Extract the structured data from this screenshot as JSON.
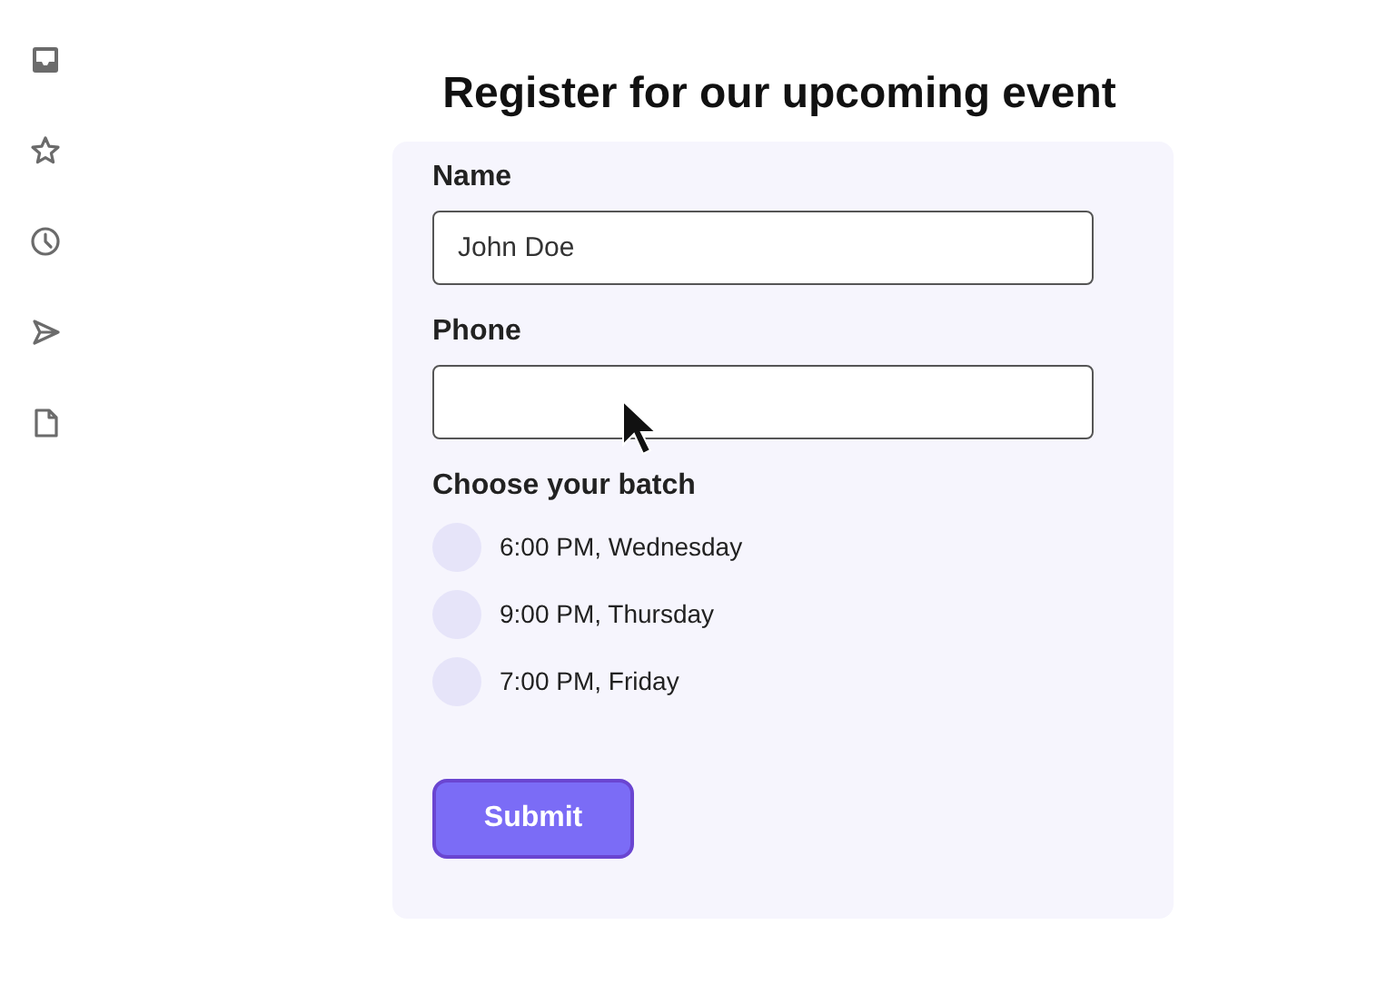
{
  "form": {
    "title": "Register for our upcoming event",
    "fields": [
      {
        "label": "Name",
        "value": "John Doe"
      },
      {
        "label": "Phone"
      }
    ],
    "batch": {
      "label": "Choose your batch",
      "options": [
        {
          "label": "6:00 PM, Wednesday",
          "selected": false
        },
        {
          "label": "9:00 PM, Thursday",
          "selected": false
        },
        {
          "label": "7:00 PM, Friday",
          "selected": false
        }
      ]
    },
    "submit": "Submit"
  }
}
